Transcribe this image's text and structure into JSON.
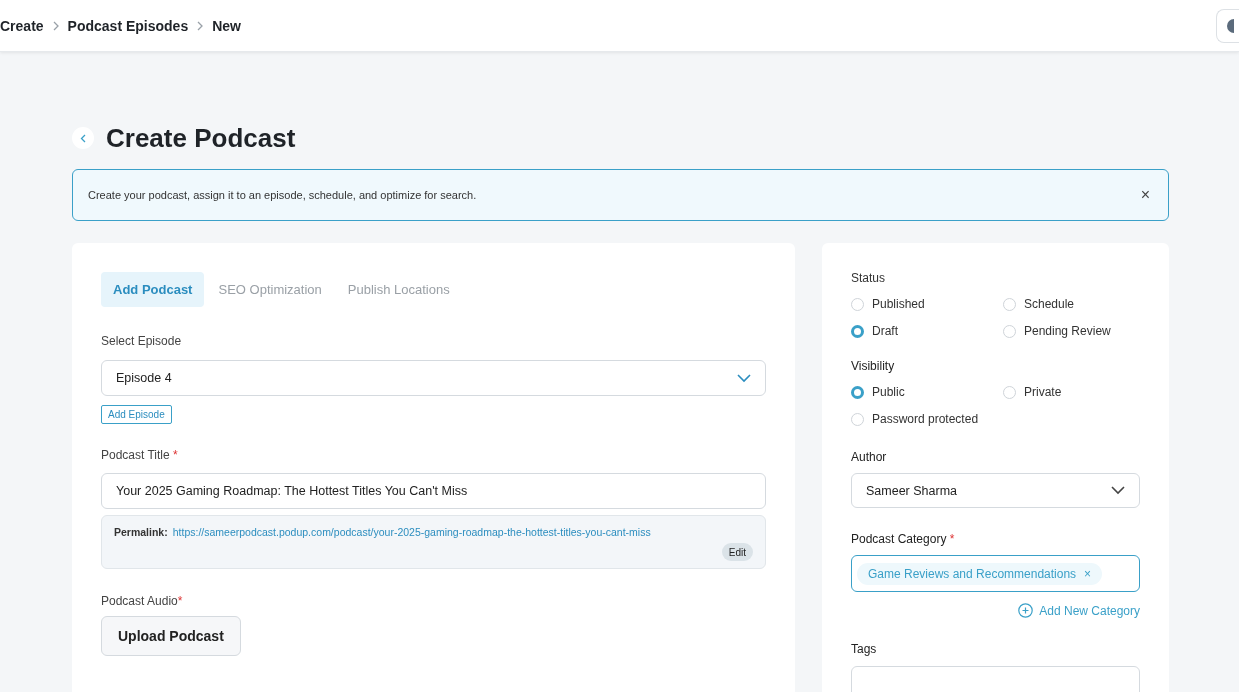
{
  "breadcrumb": [
    {
      "label": "Create"
    },
    {
      "label": "Podcast Episodes"
    },
    {
      "label": "New"
    }
  ],
  "page_title": "Create Podcast",
  "banner": {
    "text": "Create your podcast, assign it to an episode, schedule, and optimize for search.",
    "close": "×"
  },
  "tabs": [
    {
      "label": "Add Podcast",
      "selected": true
    },
    {
      "label": "SEO Optimization",
      "selected": false
    },
    {
      "label": "Publish Locations",
      "selected": false
    }
  ],
  "select_episode": {
    "label": "Select Episode",
    "value": "Episode 4"
  },
  "add_episode_button": "Add Episode",
  "podcast_title": {
    "label": "Podcast Title",
    "required_mark": "*",
    "value": "Your 2025 Gaming Roadmap: The Hottest Titles You Can't Miss"
  },
  "permalink": {
    "label": "Permalink:",
    "url": "https://sameerpodcast.podup.com/podcast/your-2025-gaming-roadmap-the-hottest-titles-you-cant-miss",
    "edit_button": "Edit"
  },
  "podcast_audio": {
    "label": "Podcast Audio",
    "required_mark": "*",
    "button": "Upload Podcast"
  },
  "status": {
    "label": "Status",
    "options": [
      {
        "label": "Published",
        "selected": false
      },
      {
        "label": "Schedule",
        "selected": false
      },
      {
        "label": "Draft",
        "selected": true
      },
      {
        "label": "Pending Review",
        "selected": false
      }
    ]
  },
  "visibility": {
    "label": "Visibility",
    "options": [
      {
        "label": "Public",
        "selected": true
      },
      {
        "label": "Private",
        "selected": false
      },
      {
        "label": "Password protected",
        "selected": false
      }
    ]
  },
  "author": {
    "label": "Author",
    "value": "Sameer Sharma"
  },
  "category": {
    "label": "Podcast Category",
    "required_mark": "*",
    "tags": [
      {
        "label": "Game Reviews and Recommendations",
        "remove": "×"
      }
    ],
    "add_button": "Add New Category"
  },
  "tags_field": {
    "label": "Tags"
  }
}
